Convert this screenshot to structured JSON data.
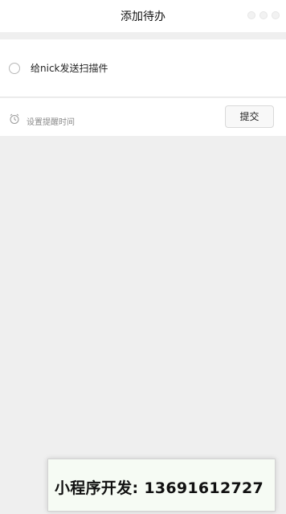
{
  "nav": {
    "title": "添加待办"
  },
  "todo": {
    "text": "给nick发送扫描件"
  },
  "actions": {
    "reminder_label": "设置提醒时间",
    "submit_label": "提交"
  },
  "overlay": {
    "text": "小程序开发: 13691612727"
  },
  "icons": {
    "capsule": "more-dots-icon",
    "radio": "radio-circle-icon",
    "reminder": "alarm-clock-icon"
  },
  "colors": {
    "page_bg": "#efefef",
    "panel_bg": "#ffffff",
    "muted_text": "#8a8a8a",
    "watermark_bg": "#f6fbf4"
  }
}
